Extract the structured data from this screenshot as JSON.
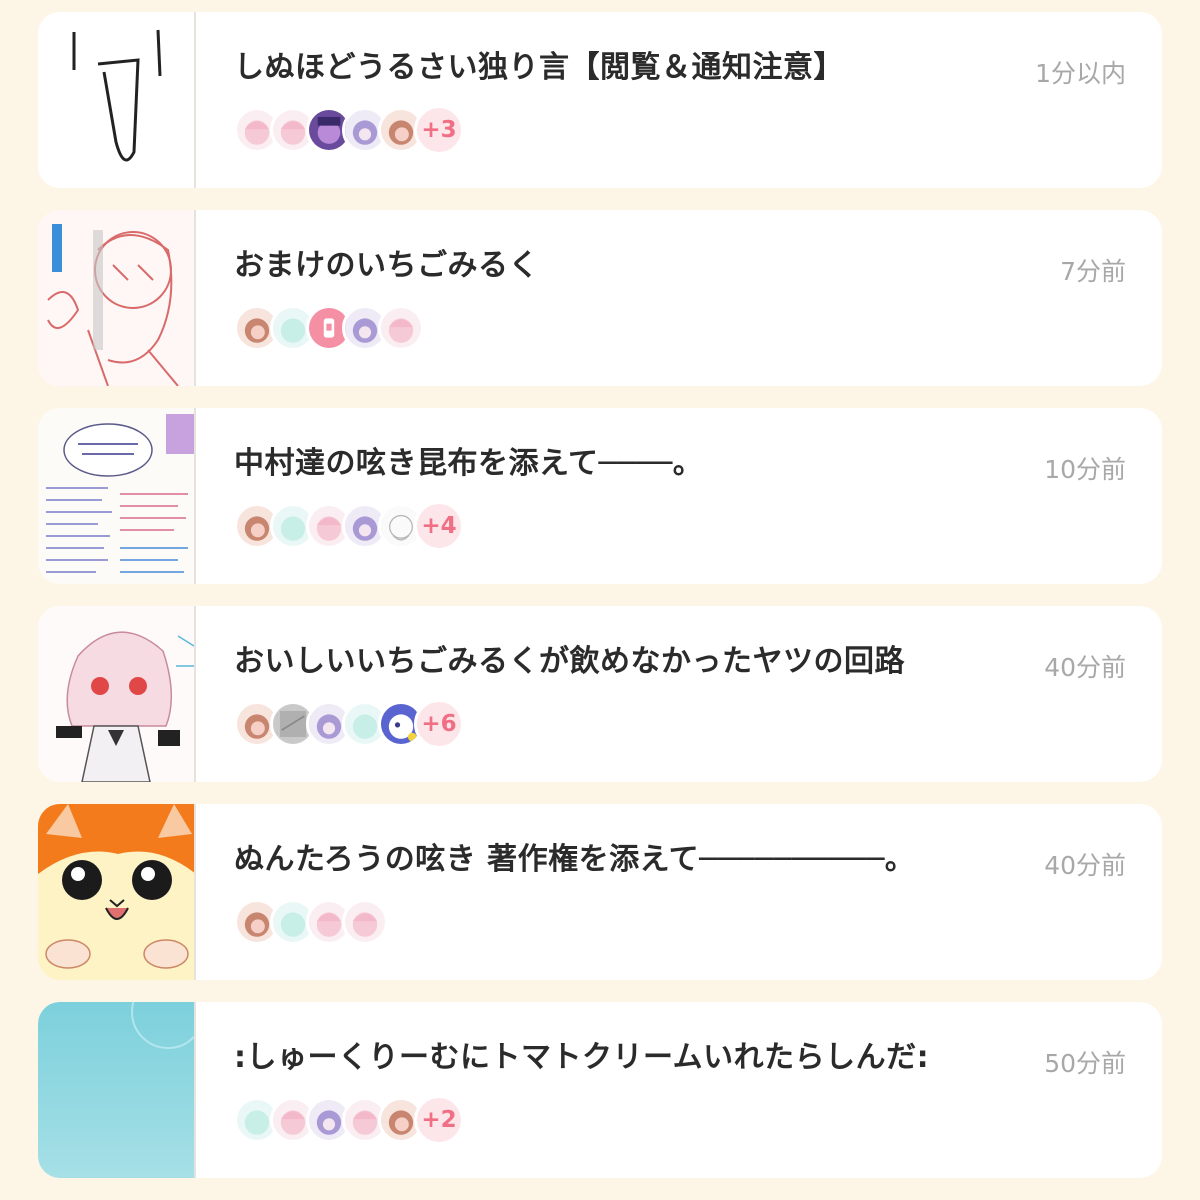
{
  "threads": [
    {
      "title": "しぬほどうるさい独り言【閲覧＆通知注意】",
      "time": "1分以内",
      "thumb": "sketch-white",
      "avatars": [
        "pink-hair",
        "pink-hair",
        "purple-character",
        "purple-hair",
        "brown-hair"
      ],
      "more": "+3"
    },
    {
      "title": "おまけのいちごみるく",
      "time": "7分前",
      "thumb": "red-sketch",
      "avatars": [
        "brown-hair",
        "mint",
        "pink-bottle",
        "purple-hair",
        "pink-hair"
      ],
      "more": ""
    },
    {
      "title": "中村達の呟き昆布を添えて────。",
      "time": "10分前",
      "thumb": "handwritten-notes",
      "avatars": [
        "brown-hair",
        "mint",
        "pink-hair",
        "purple-hair",
        "white-sketch"
      ],
      "more": "+4"
    },
    {
      "title": "おいしいいちごみるくが飲めなかったヤツの回路",
      "time": "40分前",
      "thumb": "maid-drawing",
      "avatars": [
        "brown-hair",
        "gray",
        "purple-hair",
        "mint",
        "blue-character"
      ],
      "more": "+6"
    },
    {
      "title": "ぬんたろうの呟き 著作権を添えて──────────。",
      "time": "40分前",
      "thumb": "hamster",
      "avatars": [
        "brown-hair",
        "mint",
        "pink-hair",
        "pink-hair"
      ],
      "more": ""
    },
    {
      "title": ":しゅーくりーむにトマトクリームいれたらしんだ:",
      "time": "50分前",
      "thumb": "sky-blue",
      "avatars": [
        "mint",
        "pink-hair",
        "purple-hair",
        "pink-hair",
        "brown-hair"
      ],
      "more": "+2"
    }
  ]
}
